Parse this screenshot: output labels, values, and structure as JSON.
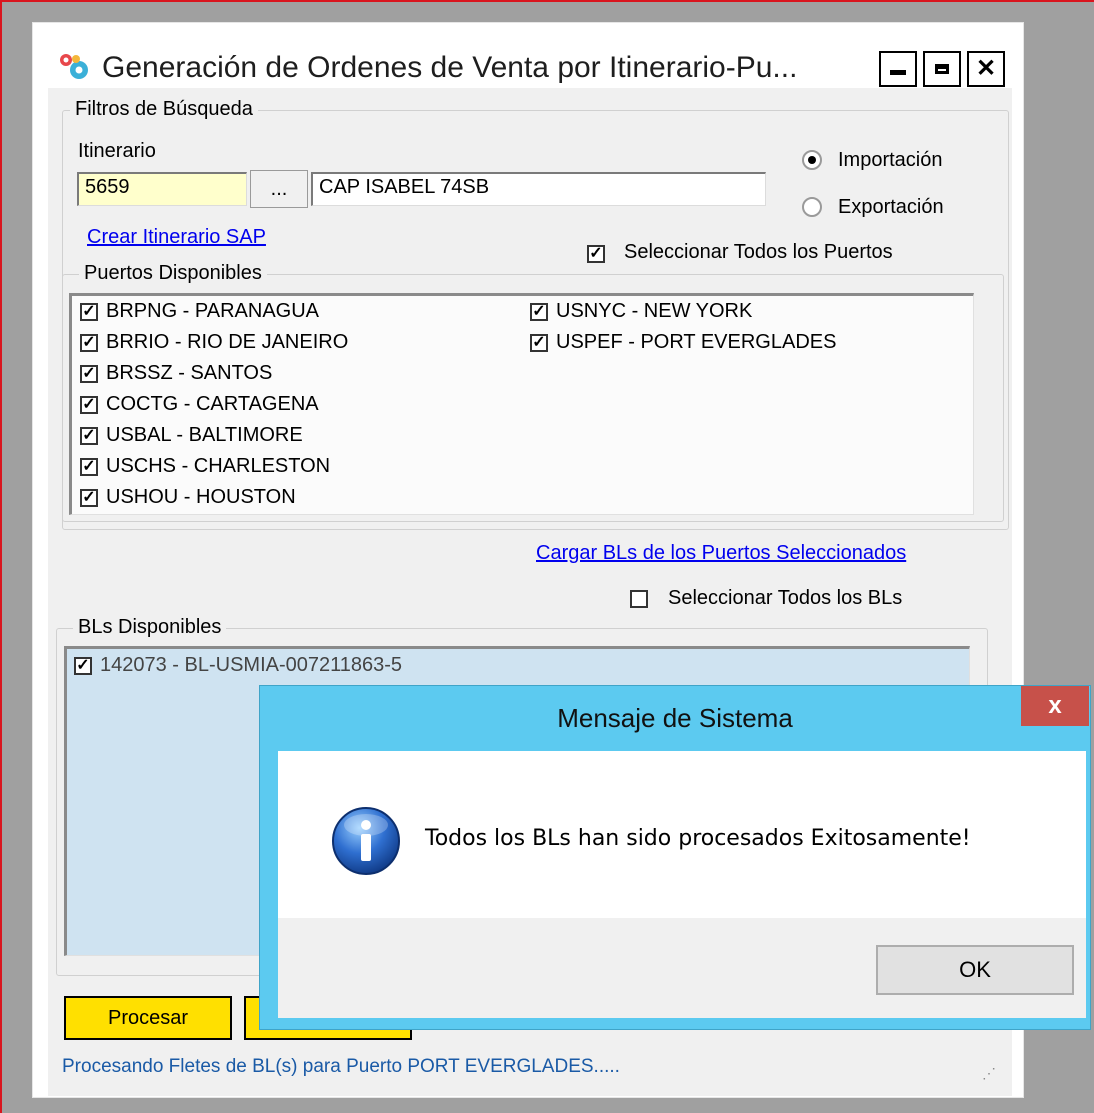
{
  "main_window": {
    "title": "Generación de Ordenes de Venta por Itinerario-Pu...",
    "controls": {
      "minimize": "minimize",
      "maximize": "maximize",
      "close": "close"
    }
  },
  "filters": {
    "group_label": "Filtros de Búsqueda",
    "itinerario_label": "Itinerario",
    "itinerario_code": "5659",
    "browse_button": "...",
    "itinerario_name": "CAP ISABEL 74SB",
    "radio_import": "Importación",
    "radio_export": "Exportación",
    "selected_mode": "Importación",
    "create_link": "Crear Itinerario SAP",
    "select_all_ports": "Seleccionar Todos los Puertos",
    "select_all_ports_checked": true
  },
  "ports": {
    "group_label": "Puertos Disponibles",
    "column1": [
      {
        "label": "BRPNG - PARANAGUA",
        "checked": true
      },
      {
        "label": "BRRIO - RIO DE JANEIRO",
        "checked": true
      },
      {
        "label": "BRSSZ - SANTOS",
        "checked": true
      },
      {
        "label": "COCTG - CARTAGENA",
        "checked": true
      },
      {
        "label": "USBAL - BALTIMORE",
        "checked": true
      },
      {
        "label": "USCHS - CHARLESTON",
        "checked": true
      },
      {
        "label": "USHOU - HOUSTON",
        "checked": true
      }
    ],
    "column2": [
      {
        "label": "USNYC - NEW YORK",
        "checked": true
      },
      {
        "label": "USPEF - PORT EVERGLADES",
        "checked": true
      }
    ]
  },
  "load_bls_link": "Cargar BLs de los Puertos Seleccionados",
  "select_all_bls": "Seleccionar Todos los BLs",
  "select_all_bls_checked": false,
  "bls": {
    "group_label": "BLs Disponibles",
    "items": [
      {
        "label": "142073 - BL-USMIA-007211863-5",
        "checked": true
      }
    ]
  },
  "process_button": "Procesar",
  "status_text": "Procesando Fletes de BL(s) para Puerto  PORT EVERGLADES.....",
  "dialog": {
    "title": "Mensaje de Sistema",
    "close_glyph": "x",
    "message": "Todos los BLs han sido procesados Exitosamente!",
    "ok_button": "OK",
    "icon": "info-icon"
  },
  "colors": {
    "accent_yellow": "#ffe000",
    "link_blue": "#0000ee",
    "dialog_title_bar": "#5ccaf0",
    "dialog_close": "#c7514a",
    "frame_red": "#d9151e",
    "status_text": "#1a5aa6"
  }
}
